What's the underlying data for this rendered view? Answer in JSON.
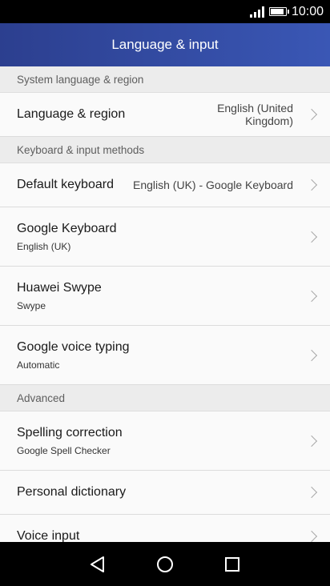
{
  "status_bar": {
    "time": "10:00"
  },
  "header": {
    "title": "Language & input"
  },
  "sections": {
    "system": {
      "label": "System language & region",
      "language_region": {
        "title": "Language & region",
        "value": "English (United\nKingdom)"
      }
    },
    "keyboard": {
      "label": "Keyboard & input methods",
      "default_keyboard": {
        "title": "Default keyboard",
        "value": "English (UK) - Google Keyboard"
      },
      "google_keyboard": {
        "title": "Google Keyboard",
        "subtitle": "English (UK)"
      },
      "huawei_swype": {
        "title": "Huawei Swype",
        "subtitle": "Swype"
      },
      "google_voice": {
        "title": "Google voice typing",
        "subtitle": "Automatic"
      }
    },
    "advanced": {
      "label": "Advanced",
      "spelling": {
        "title": "Spelling correction",
        "subtitle": "Google Spell Checker"
      },
      "dictionary": {
        "title": "Personal dictionary"
      },
      "voice_input": {
        "title": "Voice input"
      }
    }
  },
  "icons": {
    "signal": "signal-icon",
    "battery": "battery-icon",
    "chevron": "chevron-right-icon",
    "back": "back-triangle-icon",
    "home": "home-circle-icon",
    "recents": "recents-square-icon"
  },
  "colors": {
    "header_start": "#2c3f8f",
    "header_end": "#3a57b5"
  }
}
